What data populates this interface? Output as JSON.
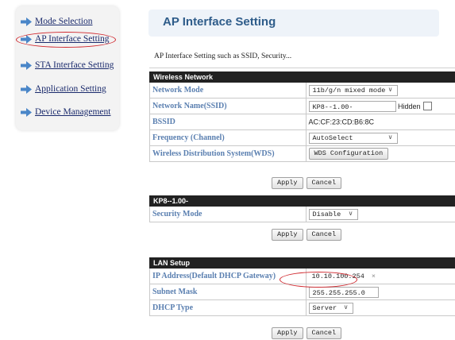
{
  "sidebar": {
    "items": [
      {
        "label": "Mode Selection"
      },
      {
        "label": "AP Interface Setting"
      },
      {
        "label": "STA Interface Setting"
      },
      {
        "label": "Application Setting"
      },
      {
        "label": "Device Management"
      }
    ]
  },
  "page": {
    "title": "AP Interface Setting",
    "subtitle": "AP Interface Setting such as SSID, Security..."
  },
  "wireless": {
    "header": "Wireless Network",
    "network_mode_label": "Network Mode",
    "network_mode_value": "11b/g/n mixed mode",
    "ssid_label": "Network Name(SSID)",
    "ssid_value": "KP8--1.00-",
    "hidden_label": "Hidden",
    "bssid_label": "BSSID",
    "bssid_value": "AC:CF:23:CD:B6:8C",
    "frequency_label": "Frequency (Channel)",
    "frequency_value": "AutoSelect",
    "wds_label": "Wireless Distribution System(WDS)",
    "wds_button": "WDS Configuration",
    "apply": "Apply",
    "cancel": "Cancel"
  },
  "security": {
    "header": "KP8--1.00-",
    "mode_label": "Security Mode",
    "mode_value": "Disable",
    "apply": "Apply",
    "cancel": "Cancel"
  },
  "lan": {
    "header": "LAN Setup",
    "ip_label": "IP Address(Default DHCP Gateway)",
    "ip_value": "10.10.100.254",
    "ip_clear": "×",
    "mask_label": "Subnet Mask",
    "mask_value": "255.255.255.0",
    "dhcp_label": "DHCP Type",
    "dhcp_value": "Server",
    "apply": "Apply",
    "cancel": "Cancel"
  },
  "colors": {
    "nav_arrow": "#4a86c8",
    "highlight": "#d0282e",
    "label_blue": "#5a7fb0",
    "title_blue": "#2e5c8a"
  },
  "icons": {
    "nav": "arrow-right-icon",
    "select": "chevron-down-icon"
  }
}
